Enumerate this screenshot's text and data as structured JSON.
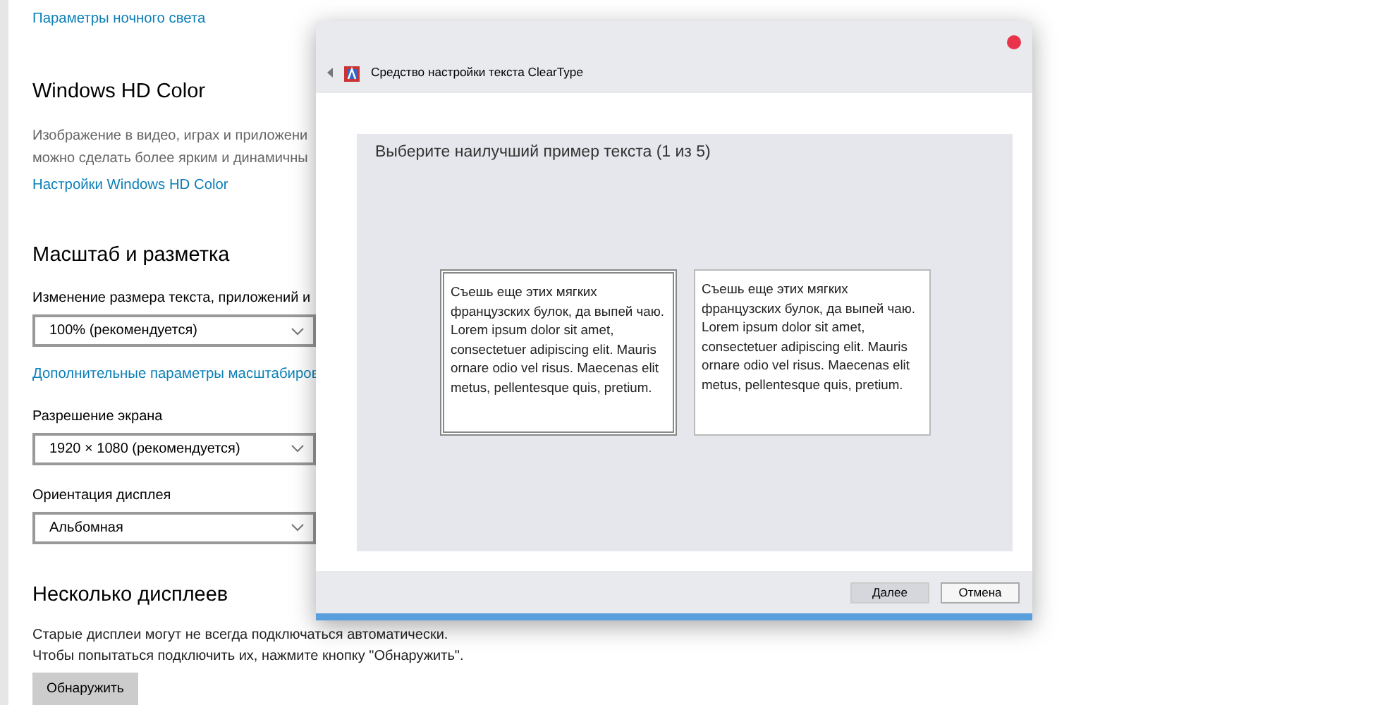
{
  "settings": {
    "night_light_link": "Параметры ночного света",
    "hd_color": {
      "heading": "Windows HD Color",
      "description": [
        "Изображение в видео, играх и приложени",
        "можно сделать более ярким и динамичны"
      ],
      "link": "Настройки Windows HD Color"
    },
    "scale": {
      "heading": "Масштаб и разметка",
      "fields": [
        {
          "label": "Изменение размера текста, приложений и",
          "value": "100% (рекомендуется)",
          "link": "Дополнительные параметры масштабиров"
        },
        {
          "label": "Разрешение экрана",
          "value": "1920 × 1080 (рекомендуется)"
        },
        {
          "label": "Ориентация дисплея",
          "value": "Альбомная"
        }
      ]
    },
    "displays": {
      "heading": "Несколько дисплеев",
      "description": [
        "Старые дисплеи могут не всегда подключаться автоматически.",
        "Чтобы попытаться подключить их, нажмите кнопку \"Обнаружить\"."
      ],
      "button": "Обнаружить"
    }
  },
  "dialog": {
    "title": "Средство настройки текста ClearType",
    "prompt": "Выберите наилучший пример текста (1 из 5)",
    "samples": [
      {
        "text": "Съешь еще этих мягких французских булок, да выпей чаю. Lorem ipsum dolor sit amet, consectetuer adipiscing elit. Mauris ornare odio vel risus. Maecenas elit metus, pellentesque quis, pretium.",
        "selected": true
      },
      {
        "text": "Съешь еще этих мягких французских булок, да выпей чаю. Lorem ipsum dolor sit amet, consectetuer adipiscing elit. Mauris ornare odio vel risus. Maecenas elit metus, pellentesque quis, pretium.",
        "selected": false
      }
    ],
    "buttons": [
      {
        "label": "Далее",
        "kind": "primary"
      },
      {
        "label": "Отмена",
        "kind": "secondary"
      }
    ]
  }
}
